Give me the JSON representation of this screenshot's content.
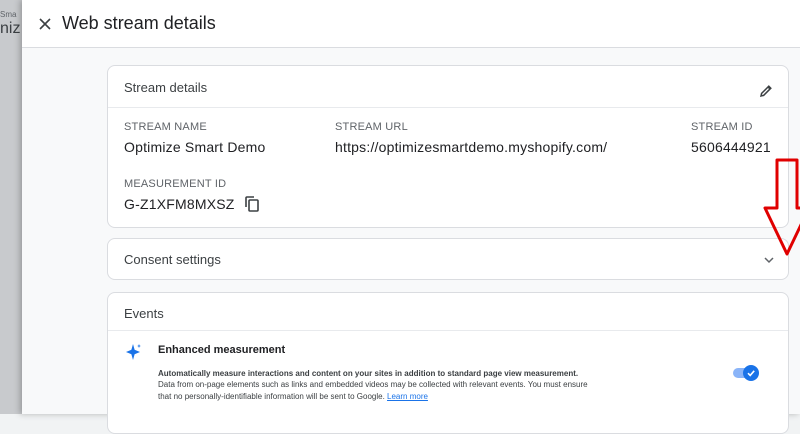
{
  "background": {
    "text_small": "Sma",
    "text_big": "niz"
  },
  "header": {
    "title": "Web stream details"
  },
  "stream_details": {
    "heading": "Stream details",
    "stream_name_label": "STREAM NAME",
    "stream_name": "Optimize Smart Demo",
    "stream_url_label": "STREAM URL",
    "stream_url": "https://optimizesmartdemo.myshopify.com/",
    "stream_id_label": "STREAM ID",
    "stream_id": "5606444921",
    "measurement_id_label": "MEASUREMENT ID",
    "measurement_id": "G-Z1XFM8MXSZ"
  },
  "consent": {
    "heading": "Consent settings"
  },
  "events": {
    "heading": "Events",
    "enhanced_title": "Enhanced measurement",
    "enhanced_desc_bold": "Automatically measure interactions and content on your sites in addition to standard page view measurement.",
    "enhanced_desc": "Data from on-page elements such as links and embedded videos may be collected with relevant events. You must ensure that no personally-identifiable information will be sent to Google.",
    "learn_more": "Learn more",
    "enhanced_enabled": true
  },
  "colors": {
    "accent": "#1a73e8",
    "annotation_arrow": "#e00000"
  }
}
